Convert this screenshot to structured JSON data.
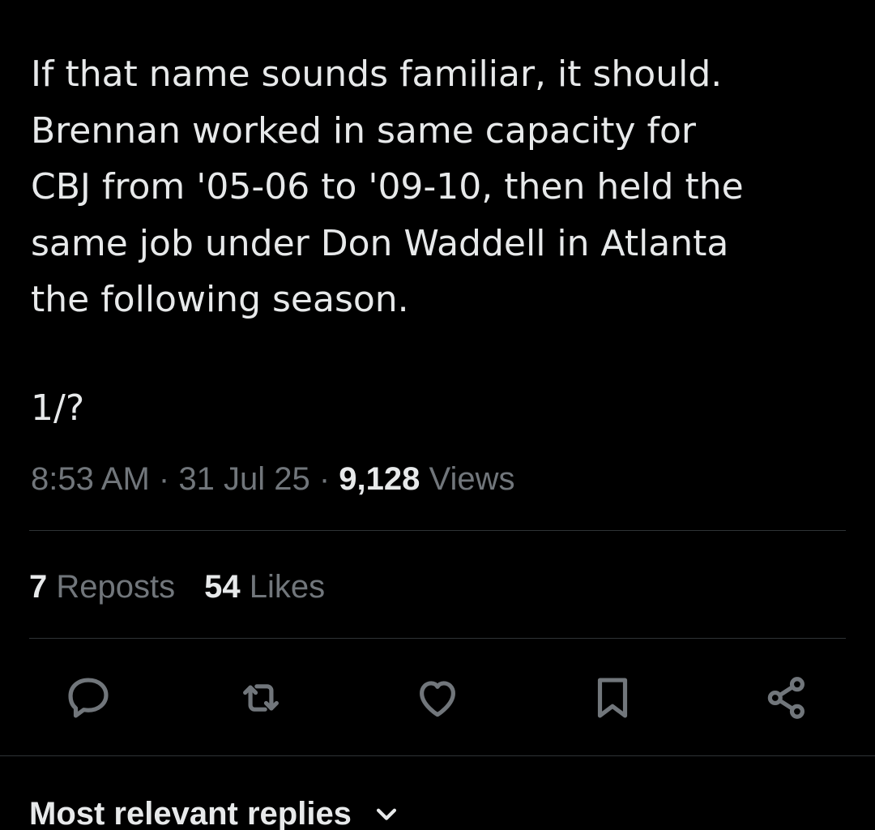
{
  "tweet": {
    "text_lines": [
      "If that name sounds familiar, it should.",
      "Brennan worked in same capacity for",
      "CBJ from '05-06 to '09-10, then held the",
      "same job under Don Waddell in Atlanta",
      "the following season."
    ],
    "thread_marker": "1/?",
    "time": "8:53 AM",
    "separator": "·",
    "date": "31 Jul 25",
    "views_count": "9,128",
    "views_label": "Views"
  },
  "engagement": {
    "reposts_count": "7",
    "reposts_label": "Reposts",
    "likes_count": "54",
    "likes_label": "Likes"
  },
  "actions": {
    "reply_icon": "reply-icon",
    "repost_icon": "repost-icon",
    "like_icon": "heart-icon",
    "bookmark_icon": "bookmark-icon",
    "share_icon": "share-icon"
  },
  "replies": {
    "sort_label": "Most relevant replies",
    "chevron_icon": "chevron-down-icon"
  },
  "colors": {
    "background": "#000000",
    "primary_text": "#e7e9ea",
    "secondary_text": "#71767b",
    "divider": "#2f3336"
  }
}
